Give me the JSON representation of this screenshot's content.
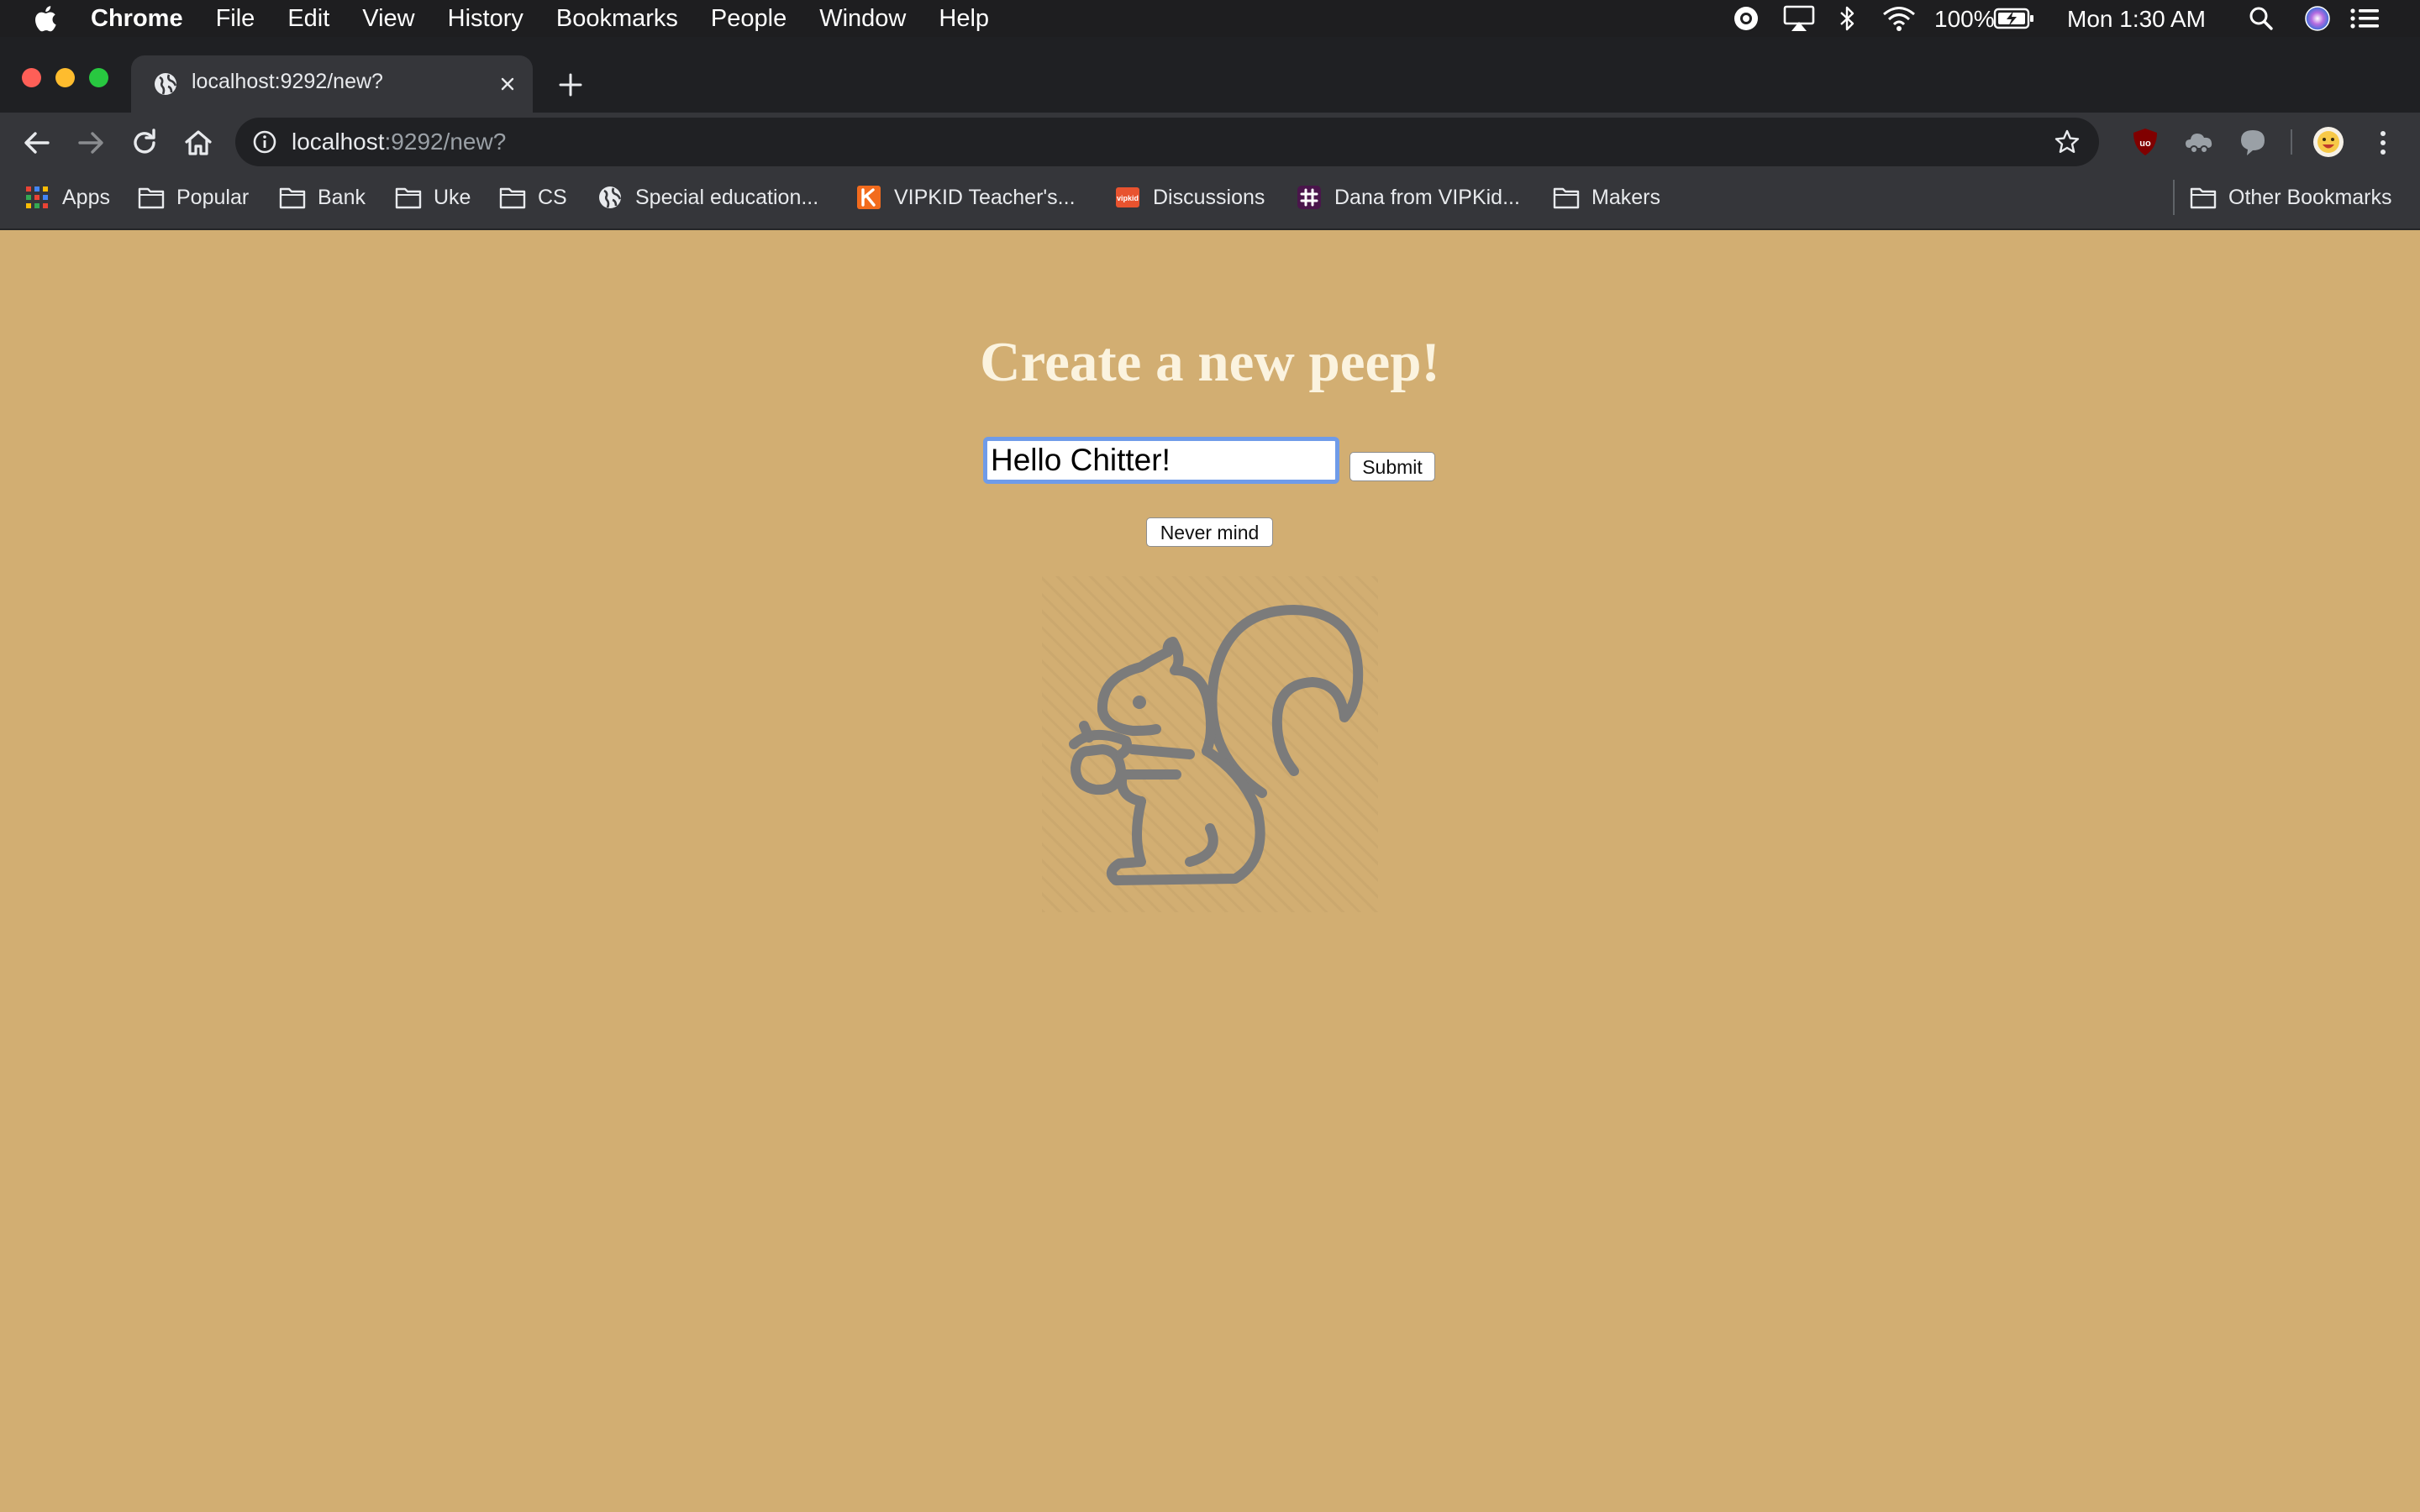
{
  "menubar": {
    "app_name": "Chrome",
    "items": [
      "File",
      "Edit",
      "View",
      "History",
      "Bookmarks",
      "People",
      "Window",
      "Help"
    ],
    "battery": "100%",
    "clock": "Mon 1:30 AM"
  },
  "tab": {
    "title": "localhost:9292/new?"
  },
  "address_bar": {
    "host": "localhost",
    "path": ":9292/new?"
  },
  "bookmarks": [
    {
      "label": "Apps",
      "icon": "apps-grid-icon"
    },
    {
      "label": "Popular",
      "icon": "folder-icon"
    },
    {
      "label": "Bank",
      "icon": "folder-icon"
    },
    {
      "label": "Uke",
      "icon": "folder-icon"
    },
    {
      "label": "CS",
      "icon": "folder-icon"
    },
    {
      "label": "Special education...",
      "icon": "globe-icon"
    },
    {
      "label": "VIPKID Teacher's...",
      "icon": "vipkid-icon"
    },
    {
      "label": "Discussions",
      "icon": "discussions-icon"
    },
    {
      "label": "Dana from VIPKid...",
      "icon": "slack-icon"
    },
    {
      "label": "Makers",
      "icon": "folder-icon"
    }
  ],
  "other_bookmarks": "Other Bookmarks",
  "page": {
    "heading": "Create a new peep!",
    "input_value": "Hello Chitter!",
    "submit_label": "Submit",
    "nevermind_label": "Never mind",
    "background_color": "#d2ae72",
    "heading_color": "#fbf3df",
    "illustration": "squirrel-icon"
  }
}
